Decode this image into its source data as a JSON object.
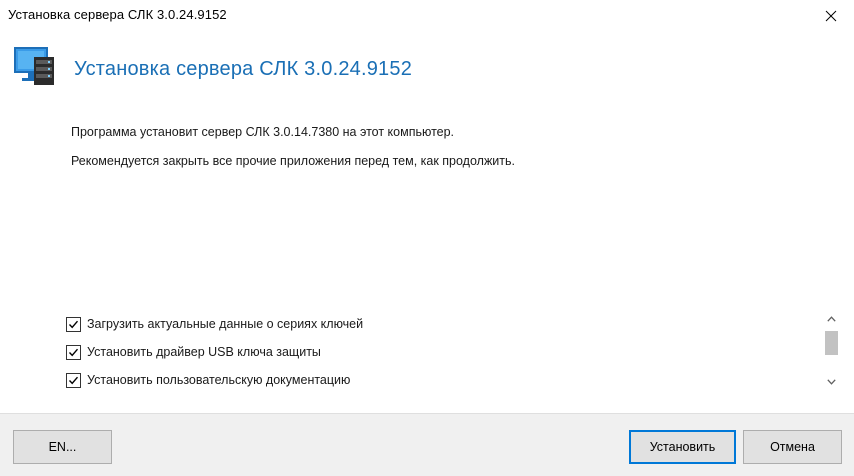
{
  "window": {
    "title": "Установка сервера СЛК 3.0.24.9152"
  },
  "header": {
    "title": "Установка сервера СЛК 3.0.24.9152",
    "icon": "server-monitor-icon"
  },
  "messages": [
    "Программа установит сервер СЛК 3.0.14.7380 на этот компьютер.",
    "Рекомендуется закрыть все прочие приложения перед тем, как продолжить."
  ],
  "options": [
    {
      "label": "Загрузить актуальные данные о сериях ключей",
      "checked": true
    },
    {
      "label": "Установить драйвер USB ключа защиты",
      "checked": true
    },
    {
      "label": "Установить пользовательскую документацию",
      "checked": true
    }
  ],
  "footer": {
    "lang_label": "EN...",
    "install_label": "Установить",
    "cancel_label": "Отмена"
  },
  "colors": {
    "accent": "#1a6fb5",
    "focus_border": "#0078d7",
    "footer_bg": "#f0f0f0"
  }
}
